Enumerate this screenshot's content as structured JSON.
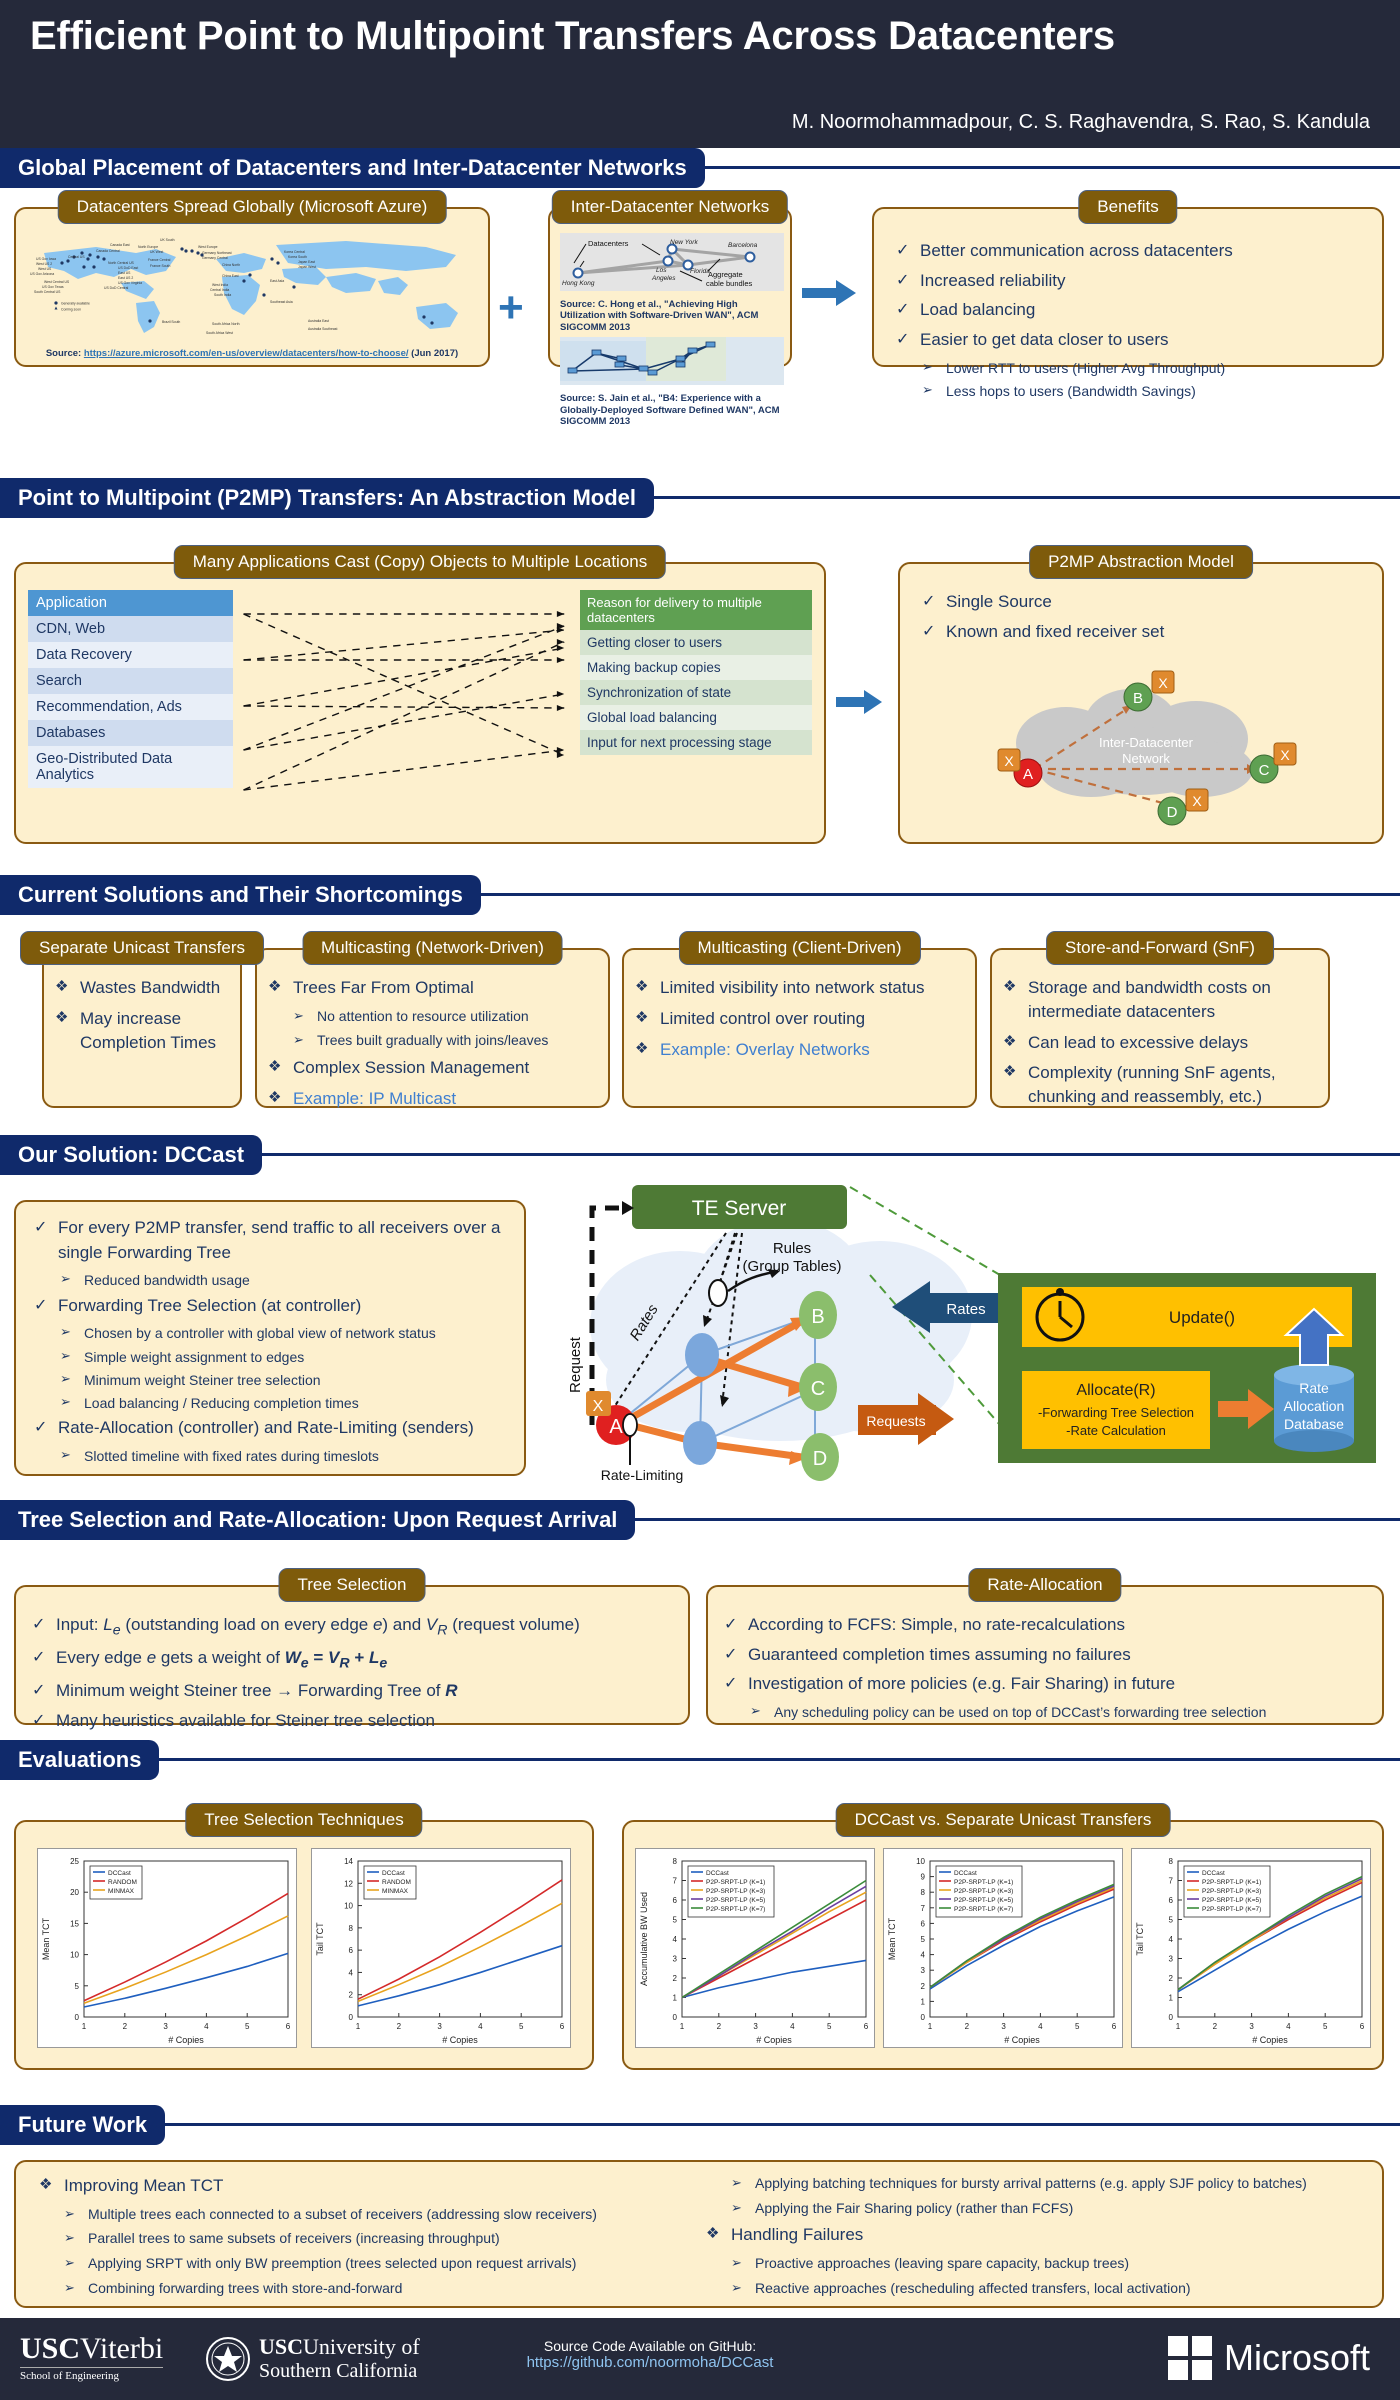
{
  "header": {
    "title": "Efficient Point to Multipoint Transfers Across Datacenters",
    "authors": "M. Noormohammadpour, C. S. Raghavendra, S. Rao, S. Kandula"
  },
  "sections": {
    "s1": "Global Placement of Datacenters and Inter-Datacenter Networks",
    "s2": "Point to Multipoint (P2MP) Transfers: An Abstraction Model",
    "s3": "Current Solutions and Their Shortcomings",
    "s4": "Our Solution: DCCast",
    "s5": "Tree Selection and Rate-Allocation: Upon Request Arrival",
    "s6": "Evaluations",
    "s7": "Future Work"
  },
  "panels": {
    "datacenters": {
      "title": "Datacenters Spread Globally (Microsoft Azure)",
      "source_prefix": "Source:",
      "source_link": "https://azure.microsoft.com/en-us/overview/datacenters/how-to-choose/",
      "source_date": "(Jun 2017)",
      "legend": [
        "Generally available",
        "Coming soon"
      ],
      "map_labels": [
        "Canada East",
        "Canada Central",
        "US Gov Iowa",
        "Central US",
        "West US 2",
        "West US",
        "US Gov Arizona",
        "North Central US",
        "US DoD East",
        "East US",
        "East US 2",
        "US Gov Virginia",
        "West Central US",
        "US Gov Texas",
        "South Central US",
        "US DoD Central",
        "UK South",
        "UK West",
        "North Europe",
        "West Europe",
        "Germany Northeast",
        "Germany Central",
        "France Central",
        "France South",
        "Korea Central",
        "Korea South",
        "China North",
        "China East",
        "Japan East",
        "Japan West",
        "West India",
        "Central India",
        "South India",
        "East Asia",
        "Southeast Asia",
        "Brazil South",
        "South Africa North",
        "South Africa West",
        "Australia East",
        "Australia Southeast"
      ]
    },
    "interdc": {
      "title": "Inter-Datacenter Networks",
      "img1_labels": [
        "Datacenters",
        "New York",
        "Barcelona",
        "Los Angeles",
        "Florida",
        "Hong Kong",
        "Aggregate cable bundles"
      ],
      "source1": "Source: C. Hong et al., \"Achieving High Utilization with Software-Driven WAN\", ACM SIGCOMM 2013",
      "source2": "Source: S. Jain et al., \"B4: Experience with a Globally-Deployed Software Defined WAN\", ACM SIGCOMM 2013"
    },
    "benefits": {
      "title": "Benefits",
      "items": [
        {
          "text": "Better communication across datacenters",
          "level": 0
        },
        {
          "text": "Increased reliability",
          "level": 0
        },
        {
          "text": "Load balancing",
          "level": 0
        },
        {
          "text": "Easier to get data closer to users",
          "level": 0
        },
        {
          "text": "Lower RTT to users (Higher Avg Throughput)",
          "level": 1
        },
        {
          "text": "Less hops to users (Bandwidth Savings)",
          "level": 1
        }
      ]
    },
    "manyapps": {
      "title": "Many Applications Cast (Copy) Objects to Multiple Locations",
      "app_header": "Application",
      "apps": [
        "CDN, Web",
        "Data Recovery",
        "Search",
        "Recommendation, Ads",
        "Databases",
        "Geo-Distributed Data Analytics"
      ],
      "reason_header": "Reason for delivery to multiple datacenters",
      "reasons": [
        "Getting closer to users",
        "Making backup copies",
        "Synchronization of state",
        "Global load balancing",
        "Input for next processing stage"
      ]
    },
    "p2mp": {
      "title": "P2MP Abstraction Model",
      "items": [
        "Single Source",
        "Known and fixed receiver set"
      ],
      "cloud_label": "Inter-Datacenter Network",
      "nodes": [
        "A",
        "B",
        "C",
        "D"
      ],
      "badge": "X"
    },
    "unicast": {
      "title": "Separate Unicast Transfers",
      "items": [
        {
          "text": "Wastes Bandwidth",
          "level": 0,
          "blue": false
        },
        {
          "text": "May increase Completion Times",
          "level": 0,
          "blue": false
        }
      ]
    },
    "mcast_net": {
      "title": "Multicasting (Network-Driven)",
      "items": [
        {
          "text": "Trees Far From Optimal",
          "level": 0,
          "blue": false
        },
        {
          "text": "No attention to resource utilization",
          "level": 1,
          "blue": false
        },
        {
          "text": "Trees built gradually with joins/leaves",
          "level": 1,
          "blue": false
        },
        {
          "text": "Complex Session Management",
          "level": 0,
          "blue": false
        },
        {
          "text": "Example: IP Multicast",
          "level": 0,
          "blue": true
        }
      ]
    },
    "mcast_client": {
      "title": "Multicasting (Client-Driven)",
      "items": [
        {
          "text": "Limited visibility into network status",
          "level": 0,
          "blue": false
        },
        {
          "text": "Limited control over routing",
          "level": 0,
          "blue": false
        },
        {
          "text": "Example: Overlay Networks",
          "level": 0,
          "blue": true
        }
      ]
    },
    "snf": {
      "title": "Store-and-Forward (SnF)",
      "items": [
        {
          "text": "Storage and bandwidth costs on intermediate datacenters",
          "level": 0,
          "blue": false
        },
        {
          "text": "Can lead to excessive delays",
          "level": 0,
          "blue": false
        },
        {
          "text": "Complexity (running SnF agents, chunking and reassembly, etc.)",
          "level": 0,
          "blue": false
        }
      ]
    },
    "dccast": {
      "items": [
        {
          "text": "For every P2MP transfer, send traffic to all receivers over a single Forwarding Tree",
          "level": 0,
          "italic_tail": "Forwarding Tree"
        },
        {
          "text": "Reduced bandwidth usage",
          "level": 1
        },
        {
          "text": "Forwarding Tree Selection (at controller)",
          "level": 0
        },
        {
          "text": "Chosen by a controller with global view of network status",
          "level": 1
        },
        {
          "text": "Simple weight assignment to edges",
          "level": 1
        },
        {
          "text": "Minimum weight Steiner tree selection",
          "level": 1
        },
        {
          "text": "Load balancing / Reducing completion times",
          "level": 1
        },
        {
          "text": "Rate-Allocation (controller) and Rate-Limiting (senders)",
          "level": 0
        },
        {
          "text": "Slotted timeline with fixed rates during timeslots",
          "level": 1
        }
      ],
      "diagram": {
        "te_server": "TE Server",
        "rules": "Rules",
        "rules_sub": "(Group Tables)",
        "request": "Request",
        "rates_label": "Rates",
        "rate_limiting": "Rate-Limiting",
        "nodes": [
          "A",
          "B",
          "C",
          "D"
        ],
        "badge": "X",
        "rates_arrow": "Rates",
        "requests_arrow": "Requests",
        "update": "Update()",
        "allocate": "Allocate(R)",
        "allocate_l1": "-Forwarding Tree Selection",
        "allocate_l2": "-Rate Calculation",
        "db": "Rate Allocation Database"
      }
    },
    "tree_selection": {
      "title": "Tree Selection",
      "items": [
        "Input: Le (outstanding load on every edge e) and VR (request volume)",
        "Every edge e gets a weight of We = VR + Le",
        "Minimum weight Steiner tree → Forwarding Tree of R",
        "Many heuristics available for Steiner tree selection"
      ]
    },
    "rate_allocation": {
      "title": "Rate-Allocation",
      "items": [
        {
          "text": "According to FCFS: Simple, no rate-recalculations",
          "level": 0
        },
        {
          "text": "Guaranteed completion times assuming no failures",
          "level": 0
        },
        {
          "text": "Investigation of more policies (e.g. Fair Sharing) in future",
          "level": 0
        },
        {
          "text": "Any scheduling policy can be used on top of DCCast’s forwarding tree selection",
          "level": 1
        }
      ]
    },
    "eval_left": {
      "title": "Tree Selection Techniques"
    },
    "eval_right": {
      "title": "DCCast vs. Separate Unicast Transfers"
    },
    "future": {
      "left": [
        {
          "text": "Improving Mean TCT",
          "level": 0
        },
        {
          "text": "Multiple trees each connected to a subset of receivers (addressing slow receivers)",
          "level": 1
        },
        {
          "text": "Parallel trees to same subsets of receivers (increasing throughput)",
          "level": 1
        },
        {
          "text": "Applying SRPT with only BW preemption (trees selected upon request arrivals)",
          "level": 1
        },
        {
          "text": "Combining forwarding trees with store-and-forward",
          "level": 1
        }
      ],
      "right": [
        {
          "text": "Applying batching techniques for bursty arrival patterns (e.g. apply SJF policy to batches)",
          "level": 1
        },
        {
          "text": "Applying the Fair Sharing policy (rather than FCFS)",
          "level": 1
        },
        {
          "text": "Handling Failures",
          "level": 0
        },
        {
          "text": "Proactive approaches (leaving spare capacity, backup trees)",
          "level": 1
        },
        {
          "text": "Reactive approaches (rescheduling affected transfers, local activation)",
          "level": 1
        }
      ]
    }
  },
  "footer": {
    "usc_viterbi_1": "USC",
    "usc_viterbi_2": "Viterbi",
    "usc_viterbi_sub": "School of Engineering",
    "usc_univ_1": "USC",
    "usc_univ_2": "University of",
    "usc_univ_3": "Southern California",
    "source_code": "Source Code Available on GitHub:",
    "github": "https://github.com/noormoha/DCCast",
    "microsoft": "Microsoft"
  },
  "chart_data": [
    {
      "type": "line",
      "title": "",
      "xlabel": "# Copies",
      "ylabel": "Mean TCT",
      "x": [
        1,
        2,
        3,
        4,
        5,
        6
      ],
      "xlim": [
        1,
        6
      ],
      "ylim": [
        0,
        25
      ],
      "yticks": [
        0,
        5,
        10,
        15,
        20,
        25
      ],
      "legend": [
        "DCCast",
        "RANDOM",
        "MINMAX"
      ],
      "legend_colors": [
        "#1F5FBF",
        "#D42A2A",
        "#E8A31E"
      ],
      "series": [
        {
          "name": "DCCast",
          "values": [
            1.6,
            3.0,
            4.6,
            6.3,
            8.1,
            10.2
          ]
        },
        {
          "name": "RANDOM",
          "values": [
            2.6,
            5.6,
            8.8,
            12.2,
            15.9,
            19.8
          ]
        },
        {
          "name": "MINMAX",
          "values": [
            2.2,
            4.6,
            7.2,
            10.0,
            13.0,
            16.2
          ]
        }
      ]
    },
    {
      "type": "line",
      "title": "",
      "xlabel": "# Copies",
      "ylabel": "Tail TCT",
      "x": [
        1,
        2,
        3,
        4,
        5,
        6
      ],
      "xlim": [
        1,
        6
      ],
      "ylim": [
        0,
        14
      ],
      "yticks": [
        0,
        2,
        4,
        6,
        8,
        10,
        12,
        14
      ],
      "legend": [
        "DCCast",
        "RANDOM",
        "MINMAX"
      ],
      "legend_colors": [
        "#1F5FBF",
        "#D42A2A",
        "#E8A31E"
      ],
      "series": [
        {
          "name": "DCCast",
          "values": [
            1.0,
            1.9,
            2.9,
            4.0,
            5.2,
            6.4
          ]
        },
        {
          "name": "RANDOM",
          "values": [
            1.6,
            3.4,
            5.4,
            7.6,
            9.9,
            12.3
          ]
        },
        {
          "name": "MINMAX",
          "values": [
            1.4,
            2.9,
            4.5,
            6.3,
            8.2,
            10.2
          ]
        }
      ]
    },
    {
      "type": "line",
      "title": "",
      "xlabel": "# Copies",
      "ylabel": "Accumulative BW Used",
      "x": [
        1,
        2,
        3,
        4,
        5,
        6
      ],
      "xlim": [
        1,
        6
      ],
      "ylim": [
        0,
        8
      ],
      "yticks": [
        0,
        1,
        2,
        3,
        4,
        5,
        6,
        7,
        8
      ],
      "legend": [
        "DCCast",
        "P2P-SRPT-LP (K=1)",
        "P2P-SRPT-LP (K=3)",
        "P2P-SRPT-LP (K=5)",
        "P2P-SRPT-LP (K=7)"
      ],
      "legend_colors": [
        "#1F5FBF",
        "#D42A2A",
        "#E8A31E",
        "#6B3FA0",
        "#3B8C3B"
      ],
      "series": [
        {
          "name": "DCCast",
          "values": [
            1.0,
            1.5,
            1.9,
            2.3,
            2.6,
            2.9
          ]
        },
        {
          "name": "P2P-SRPT-LP (K=1)",
          "values": [
            1.0,
            2.0,
            3.0,
            4.0,
            5.0,
            6.0
          ]
        },
        {
          "name": "P2P-SRPT-LP (K=3)",
          "values": [
            1.0,
            2.1,
            3.2,
            4.3,
            5.4,
            6.4
          ]
        },
        {
          "name": "P2P-SRPT-LP (K=5)",
          "values": [
            1.0,
            2.1,
            3.3,
            4.4,
            5.6,
            6.7
          ]
        },
        {
          "name": "P2P-SRPT-LP (K=7)",
          "values": [
            1.0,
            2.2,
            3.4,
            4.6,
            5.8,
            7.0
          ]
        }
      ]
    },
    {
      "type": "line",
      "title": "",
      "xlabel": "# Copies",
      "ylabel": "Mean TCT",
      "x": [
        1,
        2,
        3,
        4,
        5,
        6
      ],
      "xlim": [
        1,
        6
      ],
      "ylim": [
        0,
        10
      ],
      "yticks": [
        0,
        1,
        2,
        3,
        4,
        5,
        6,
        7,
        8,
        9,
        10
      ],
      "legend": [
        "DCCast",
        "P2P-SRPT-LP (K=1)",
        "P2P-SRPT-LP (K=3)",
        "P2P-SRPT-LP (K=5)",
        "P2P-SRPT-LP (K=7)"
      ],
      "legend_colors": [
        "#1F5FBF",
        "#D42A2A",
        "#E8A31E",
        "#6B3FA0",
        "#3B8C3B"
      ],
      "series": [
        {
          "name": "DCCast",
          "values": [
            1.8,
            3.3,
            4.6,
            5.8,
            6.8,
            7.7
          ]
        },
        {
          "name": "P2P-SRPT-LP (K=1)",
          "values": [
            1.9,
            3.5,
            4.9,
            6.1,
            7.2,
            8.2
          ]
        },
        {
          "name": "P2P-SRPT-LP (K=3)",
          "values": [
            1.9,
            3.5,
            5.0,
            6.2,
            7.3,
            8.3
          ]
        },
        {
          "name": "P2P-SRPT-LP (K=5)",
          "values": [
            1.9,
            3.6,
            5.0,
            6.3,
            7.4,
            8.4
          ]
        },
        {
          "name": "P2P-SRPT-LP (K=7)",
          "values": [
            1.9,
            3.6,
            5.1,
            6.4,
            7.5,
            8.5
          ]
        }
      ]
    },
    {
      "type": "line",
      "title": "",
      "xlabel": "# Copies",
      "ylabel": "Tail TCT",
      "x": [
        1,
        2,
        3,
        4,
        5,
        6
      ],
      "xlim": [
        1,
        6
      ],
      "ylim": [
        0,
        8
      ],
      "yticks": [
        0,
        1,
        2,
        3,
        4,
        5,
        6,
        7,
        8
      ],
      "legend": [
        "DCCast",
        "P2P-SRPT-LP (K=1)",
        "P2P-SRPT-LP (K=3)",
        "P2P-SRPT-LP (K=5)",
        "P2P-SRPT-LP (K=7)"
      ],
      "legend_colors": [
        "#1F5FBF",
        "#D42A2A",
        "#E8A31E",
        "#6B3FA0",
        "#3B8C3B"
      ],
      "series": [
        {
          "name": "DCCast",
          "values": [
            1.3,
            2.4,
            3.5,
            4.5,
            5.4,
            6.2
          ]
        },
        {
          "name": "P2P-SRPT-LP (K=1)",
          "values": [
            1.4,
            2.7,
            3.9,
            5.0,
            6.0,
            6.9
          ]
        },
        {
          "name": "P2P-SRPT-LP (K=3)",
          "values": [
            1.4,
            2.7,
            3.9,
            5.1,
            6.1,
            7.0
          ]
        },
        {
          "name": "P2P-SRPT-LP (K=5)",
          "values": [
            1.4,
            2.8,
            4.0,
            5.1,
            6.2,
            7.1
          ]
        },
        {
          "name": "P2P-SRPT-LP (K=7)",
          "values": [
            1.4,
            2.8,
            4.0,
            5.2,
            6.3,
            7.2
          ]
        }
      ]
    }
  ]
}
